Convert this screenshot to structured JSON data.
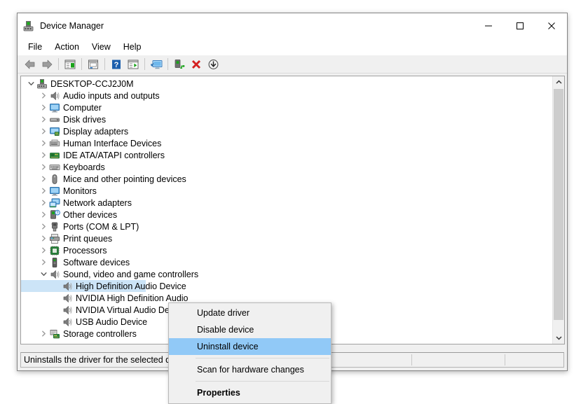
{
  "window": {
    "title": "Device Manager",
    "icon": "device-manager-icon",
    "caption_buttons": [
      {
        "name": "minimize-button",
        "glyph": "—"
      },
      {
        "name": "maximize-button",
        "glyph": "□"
      },
      {
        "name": "close-button",
        "glyph": "✕"
      }
    ]
  },
  "menubar": {
    "items": [
      {
        "label": "File"
      },
      {
        "label": "Action"
      },
      {
        "label": "View"
      },
      {
        "label": "Help"
      }
    ]
  },
  "toolbar": {
    "buttons": [
      {
        "name": "back-button",
        "icon": "back-arrow-icon"
      },
      {
        "name": "forward-button",
        "icon": "forward-arrow-icon"
      },
      {
        "name": "separator-1",
        "icon": "separator"
      },
      {
        "name": "show-hide-console-tree-button",
        "icon": "console-tree-icon"
      },
      {
        "name": "separator-2",
        "icon": "separator"
      },
      {
        "name": "properties-button",
        "icon": "properties-icon"
      },
      {
        "name": "separator-3",
        "icon": "separator"
      },
      {
        "name": "help-button",
        "icon": "help-question-icon"
      },
      {
        "name": "update-driver-button",
        "icon": "update-driver-icon"
      },
      {
        "name": "separator-4",
        "icon": "separator"
      },
      {
        "name": "scan-hardware-changes-button",
        "icon": "scan-monitor-icon"
      },
      {
        "name": "separator-5",
        "icon": "separator"
      },
      {
        "name": "enable-device-button",
        "icon": "enable-device-icon"
      },
      {
        "name": "uninstall-device-button",
        "icon": "red-x-icon"
      },
      {
        "name": "disable-device-button",
        "icon": "down-arrow-circle-icon"
      }
    ]
  },
  "tree": {
    "root": {
      "label": "DESKTOP-CCJ2J0M",
      "icon": "computer-root-icon",
      "expanded": true
    },
    "items": [
      {
        "label": "Audio inputs and outputs",
        "icon": "speaker-icon",
        "expander": "collapsed",
        "indent": 1
      },
      {
        "label": "Computer",
        "icon": "monitor-icon",
        "expander": "collapsed",
        "indent": 1
      },
      {
        "label": "Disk drives",
        "icon": "disk-drive-icon",
        "expander": "collapsed",
        "indent": 1
      },
      {
        "label": "Display adapters",
        "icon": "display-adapter-icon",
        "expander": "collapsed",
        "indent": 1
      },
      {
        "label": "Human Interface Devices",
        "icon": "hid-icon",
        "expander": "collapsed",
        "indent": 1
      },
      {
        "label": "IDE ATA/ATAPI controllers",
        "icon": "ide-controller-icon",
        "expander": "collapsed",
        "indent": 1
      },
      {
        "label": "Keyboards",
        "icon": "keyboard-icon",
        "expander": "collapsed",
        "indent": 1
      },
      {
        "label": "Mice and other pointing devices",
        "icon": "mouse-icon",
        "expander": "collapsed",
        "indent": 1
      },
      {
        "label": "Monitors",
        "icon": "monitor-icon",
        "expander": "collapsed",
        "indent": 1
      },
      {
        "label": "Network adapters",
        "icon": "network-adapter-icon",
        "expander": "collapsed",
        "indent": 1
      },
      {
        "label": "Other devices",
        "icon": "other-device-icon",
        "expander": "collapsed",
        "indent": 1
      },
      {
        "label": "Ports (COM & LPT)",
        "icon": "port-icon",
        "expander": "collapsed",
        "indent": 1
      },
      {
        "label": "Print queues",
        "icon": "printer-icon",
        "expander": "collapsed",
        "indent": 1
      },
      {
        "label": "Processors",
        "icon": "processor-icon",
        "expander": "collapsed",
        "indent": 1
      },
      {
        "label": "Software devices",
        "icon": "software-device-icon",
        "expander": "collapsed",
        "indent": 1
      },
      {
        "label": "Sound, video and game controllers",
        "icon": "speaker-icon",
        "expander": "expanded",
        "indent": 1
      },
      {
        "label": "High Definition Audio Device",
        "icon": "speaker-icon",
        "expander": "none",
        "indent": 2,
        "selected": true
      },
      {
        "label": "NVIDIA High Definition Audio",
        "icon": "speaker-icon",
        "expander": "none",
        "indent": 2
      },
      {
        "label": "NVIDIA Virtual Audio Device",
        "icon": "speaker-icon",
        "expander": "none",
        "indent": 2
      },
      {
        "label": "USB Audio Device",
        "icon": "speaker-icon",
        "expander": "none",
        "indent": 2
      },
      {
        "label": "Storage controllers",
        "icon": "storage-controller-icon",
        "expander": "collapsed",
        "indent": 1
      }
    ]
  },
  "context_menu": {
    "items": [
      {
        "label": "Update driver",
        "type": "item"
      },
      {
        "label": "Disable device",
        "type": "item"
      },
      {
        "label": "Uninstall device",
        "type": "item",
        "highlighted": true
      },
      {
        "type": "separator"
      },
      {
        "label": "Scan for hardware changes",
        "type": "item"
      },
      {
        "type": "separator"
      },
      {
        "label": "Properties",
        "type": "item",
        "bold": true
      }
    ]
  },
  "statusbar": {
    "text": "Uninstalls the driver for the selected device."
  },
  "colors": {
    "selection_blue": "#cce4f7",
    "menu_highlight_blue": "#91c9f7",
    "window_chrome": "#f0f0f0",
    "accent_red": "#d42020"
  },
  "scrollbar": {
    "up_arrow": "⌃",
    "down_arrow": "⌄"
  }
}
